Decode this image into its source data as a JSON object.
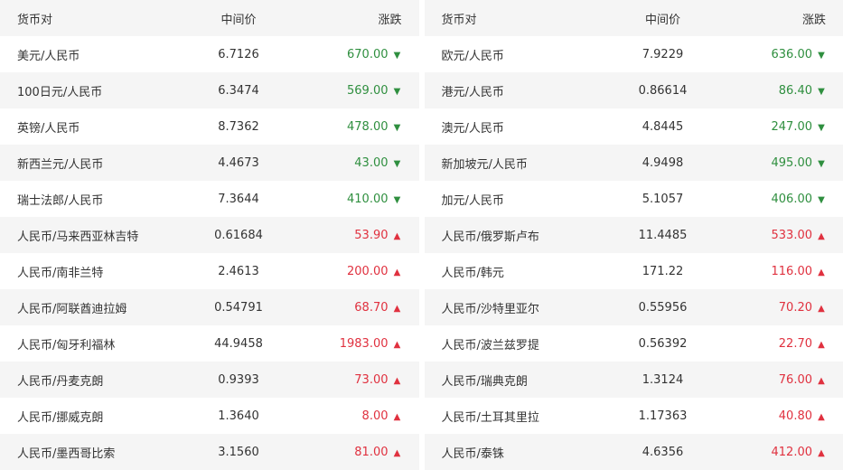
{
  "headers": {
    "pair": "货币对",
    "mid": "中间价",
    "change": "涨跌"
  },
  "colors": {
    "down": "#2f8f3f",
    "up": "#e0313f",
    "stripe": "#f5f5f5"
  },
  "icons": {
    "down": "triangle-down-icon",
    "up": "triangle-up-icon"
  },
  "left": [
    {
      "pair": "美元/人民币",
      "mid": "6.7126",
      "change": "670.00",
      "dir": "down",
      "arrow": "▼"
    },
    {
      "pair": "100日元/人民币",
      "mid": "6.3474",
      "change": "569.00",
      "dir": "down",
      "arrow": "▼"
    },
    {
      "pair": "英镑/人民币",
      "mid": "8.7362",
      "change": "478.00",
      "dir": "down",
      "arrow": "▼"
    },
    {
      "pair": "新西兰元/人民币",
      "mid": "4.4673",
      "change": "43.00",
      "dir": "down",
      "arrow": "▼"
    },
    {
      "pair": "瑞士法郎/人民币",
      "mid": "7.3644",
      "change": "410.00",
      "dir": "down",
      "arrow": "▼"
    },
    {
      "pair": "人民币/马来西亚林吉特",
      "mid": "0.61684",
      "change": "53.90",
      "dir": "up",
      "arrow": "▲"
    },
    {
      "pair": "人民币/南非兰特",
      "mid": "2.4613",
      "change": "200.00",
      "dir": "up",
      "arrow": "▲"
    },
    {
      "pair": "人民币/阿联酋迪拉姆",
      "mid": "0.54791",
      "change": "68.70",
      "dir": "up",
      "arrow": "▲"
    },
    {
      "pair": "人民币/匈牙利福林",
      "mid": "44.9458",
      "change": "1983.00",
      "dir": "up",
      "arrow": "▲"
    },
    {
      "pair": "人民币/丹麦克朗",
      "mid": "0.9393",
      "change": "73.00",
      "dir": "up",
      "arrow": "▲"
    },
    {
      "pair": "人民币/挪威克朗",
      "mid": "1.3640",
      "change": "8.00",
      "dir": "up",
      "arrow": "▲"
    },
    {
      "pair": "人民币/墨西哥比索",
      "mid": "3.1560",
      "change": "81.00",
      "dir": "up",
      "arrow": "▲"
    }
  ],
  "right": [
    {
      "pair": "欧元/人民币",
      "mid": "7.9229",
      "change": "636.00",
      "dir": "down",
      "arrow": "▼"
    },
    {
      "pair": "港元/人民币",
      "mid": "0.86614",
      "change": "86.40",
      "dir": "down",
      "arrow": "▼"
    },
    {
      "pair": "澳元/人民币",
      "mid": "4.8445",
      "change": "247.00",
      "dir": "down",
      "arrow": "▼"
    },
    {
      "pair": "新加坡元/人民币",
      "mid": "4.9498",
      "change": "495.00",
      "dir": "down",
      "arrow": "▼"
    },
    {
      "pair": "加元/人民币",
      "mid": "5.1057",
      "change": "406.00",
      "dir": "down",
      "arrow": "▼"
    },
    {
      "pair": "人民币/俄罗斯卢布",
      "mid": "11.4485",
      "change": "533.00",
      "dir": "up",
      "arrow": "▲"
    },
    {
      "pair": "人民币/韩元",
      "mid": "171.22",
      "change": "116.00",
      "dir": "up",
      "arrow": "▲"
    },
    {
      "pair": "人民币/沙特里亚尔",
      "mid": "0.55956",
      "change": "70.20",
      "dir": "up",
      "arrow": "▲"
    },
    {
      "pair": "人民币/波兰兹罗提",
      "mid": "0.56392",
      "change": "22.70",
      "dir": "up",
      "arrow": "▲"
    },
    {
      "pair": "人民币/瑞典克朗",
      "mid": "1.3124",
      "change": "76.00",
      "dir": "up",
      "arrow": "▲"
    },
    {
      "pair": "人民币/土耳其里拉",
      "mid": "1.17363",
      "change": "40.80",
      "dir": "up",
      "arrow": "▲"
    },
    {
      "pair": "人民币/泰铢",
      "mid": "4.6356",
      "change": "412.00",
      "dir": "up",
      "arrow": "▲"
    }
  ]
}
